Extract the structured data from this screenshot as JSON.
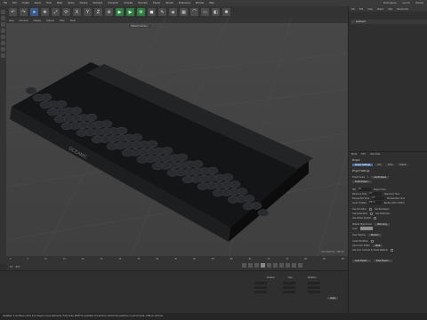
{
  "menu": [
    "File",
    "Edit",
    "Create",
    "Select",
    "Tools",
    "Mesh",
    "Spline",
    "Volume",
    "MoGraph",
    "Character",
    "Animate",
    "Simulate",
    "Tracker",
    "Render",
    "Extensions",
    "Window",
    "Help"
  ],
  "right_menu": [
    "Node Space:",
    "Layout:",
    "Startup"
  ],
  "viewport": {
    "menu": [
      "View",
      "Cameras",
      "Display",
      "Options",
      "Filter",
      "Panel"
    ],
    "camera_label": "Default Camera ·:",
    "grid_info": "Grid Spacing : 100 cm",
    "keyboard_brand": "OCEANIC"
  },
  "timeline": {
    "ticks": [
      "0",
      "5",
      "10",
      "15",
      "20",
      "25",
      "30",
      "35",
      "40",
      "45",
      "50",
      "55",
      "60",
      "65",
      "70",
      "75",
      "80",
      "85",
      "90"
    ],
    "start": "0 F",
    "end": "90 F"
  },
  "objects": {
    "tabs": [
      "File",
      "Edit",
      "View",
      "Object",
      "Tags",
      "Bookmarks"
    ],
    "row_label": "keyboard"
  },
  "attributes": {
    "tabs": [
      "Mode",
      "Edit",
      "User Data"
    ],
    "title": "Project",
    "section_tabs": [
      "Project Settings",
      "Info",
      "Todo",
      "Frame"
    ],
    "heading": "Project Settings",
    "rows": [
      {
        "label": "Project Scale",
        "value": "1",
        "unit": "Centimeters"
      },
      {
        "label": "Scale Project...",
        "value": "",
        "unit": ""
      },
      {
        "label": "FPS",
        "value": "30",
        "unit": "Project Time"
      },
      {
        "label": "Minimum Time",
        "value": "0 F",
        "unit": "Maximum Time"
      },
      {
        "label": "Preview Min Time",
        "value": "0 F",
        "unit": "Preview Max Time"
      },
      {
        "label": "Level of Detail",
        "value": "100 %",
        "unit": "Render LOD in Editor"
      },
      {
        "label": "Use Animation",
        "value": "",
        "unit": "Use Expression"
      },
      {
        "label": "Use Generators",
        "value": "",
        "unit": "Use Deformers"
      },
      {
        "label": "Use Motion System",
        "value": "",
        "unit": ""
      },
      {
        "label": "Default Object Color",
        "value": "",
        "unit": "80% Gray"
      },
      {
        "label": "Color",
        "value": "",
        "unit": ""
      },
      {
        "label": "View Clipping",
        "value": "",
        "unit": "Medium"
      },
      {
        "label": "Linear Workflow",
        "value": "",
        "unit": ""
      },
      {
        "label": "Input Color Profile",
        "value": "",
        "unit": "sRGB"
      },
      {
        "label": "Use Color Channel for Node Material",
        "value": "",
        "unit": ""
      }
    ],
    "buttons": [
      "Load Preset...",
      "Save Preset..."
    ]
  },
  "bottom": {
    "labels": [
      "Position",
      "Size",
      "Rotation"
    ],
    "apply": "Apply"
  },
  "status": "Updated: 0 ms  Move: Click and drag to move elements. Hold down SHIFT to quantize movement / add to the selection in point mode, CTRL to remove."
}
